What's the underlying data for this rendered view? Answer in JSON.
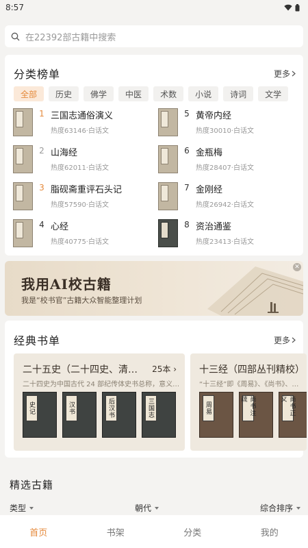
{
  "status": {
    "time": "8:57"
  },
  "search": {
    "placeholder": "在22392部古籍中搜索"
  },
  "ranking": {
    "title": "分类榜单",
    "more": "更多",
    "categories": [
      "全部",
      "历史",
      "佛学",
      "中医",
      "术数",
      "小说",
      "诗词",
      "文学"
    ],
    "items": [
      {
        "rank": "1",
        "title": "三国志通俗演义",
        "meta": "热度63146·白话文"
      },
      {
        "rank": "2",
        "title": "山海经",
        "meta": "热度62011·白话文"
      },
      {
        "rank": "3",
        "title": "脂砚斋重评石头记",
        "meta": "热度57590·白话文"
      },
      {
        "rank": "4",
        "title": "心经",
        "meta": "热度40775·白话文"
      },
      {
        "rank": "5",
        "title": "黄帝内经",
        "meta": "热度30010·白话文"
      },
      {
        "rank": "6",
        "title": "金瓶梅",
        "meta": "热度28407·白话文"
      },
      {
        "rank": "7",
        "title": "金刚经",
        "meta": "热度26942·白话文"
      },
      {
        "rank": "8",
        "title": "资治通鉴",
        "meta": "热度23413·白话文"
      }
    ]
  },
  "banner": {
    "title": "我用AI校古籍",
    "subtitle": "我是“校书官”古籍大众智能整理计划"
  },
  "classic": {
    "title": "经典书单",
    "more": "更多",
    "sets": [
      {
        "title": "二十五史（二十四史、清…",
        "count": "25本",
        "desc": "二十四史为中国古代 24 部纪传体史书总称，意义…",
        "volumes": [
          "史记",
          "汉书",
          "后汉书",
          "三国志"
        ]
      },
      {
        "title": "十三经（四部丛刊精校）",
        "desc": "“十三经”即《周易》、《尚书》、…",
        "volumes": [
          "周易",
          "尚书注疏",
          "尚书正义"
        ]
      }
    ]
  },
  "featured": {
    "title": "精选古籍",
    "filters": [
      "类型",
      "朝代",
      "综合排序"
    ]
  },
  "tabs": [
    "首页",
    "书架",
    "分类",
    "我的"
  ],
  "colors": {
    "accent": "#e58a3c",
    "chip_active_bg": "#fbe9d9",
    "background": "#f4f3f1"
  }
}
